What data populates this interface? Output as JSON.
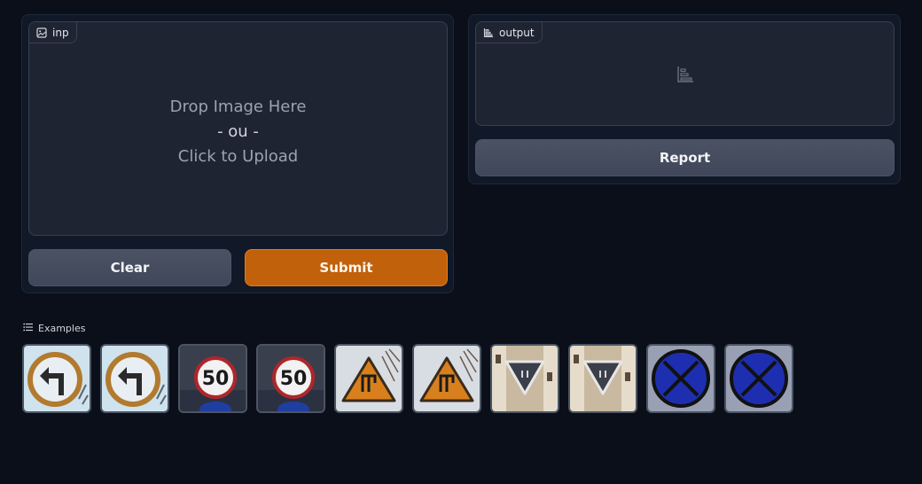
{
  "input_block": {
    "label": "inp",
    "icon": "image-icon",
    "drop_text": "Drop Image Here",
    "or_text": "- ou -",
    "click_text": "Click to Upload"
  },
  "buttons": {
    "clear": "Clear",
    "submit": "Submit",
    "report": "Report"
  },
  "output_block": {
    "label": "output",
    "icon": "bar-chart-icon"
  },
  "examples": {
    "label": "Examples",
    "icon": "list-icon",
    "items": [
      {
        "sign": "turn-left-prohibited",
        "icon": "left-turn-sign-icon"
      },
      {
        "sign": "turn-left-prohibited",
        "icon": "left-turn-sign-icon"
      },
      {
        "sign": "speed-limit",
        "value": "50",
        "icon": "speed-limit-sign-icon"
      },
      {
        "sign": "speed-limit",
        "value": "50",
        "icon": "speed-limit-sign-icon"
      },
      {
        "sign": "warning-triangle",
        "icon": "warning-sign-icon"
      },
      {
        "sign": "warning-triangle",
        "icon": "warning-sign-icon"
      },
      {
        "sign": "yield",
        "icon": "yield-sign-icon"
      },
      {
        "sign": "yield",
        "icon": "yield-sign-icon"
      },
      {
        "sign": "no-stopping",
        "icon": "no-stopping-sign-icon"
      },
      {
        "sign": "no-stopping",
        "icon": "no-stopping-sign-icon"
      }
    ]
  },
  "colors": {
    "accent": "#c2610c",
    "background": "#0b0f19",
    "panel": "#1f2433"
  }
}
